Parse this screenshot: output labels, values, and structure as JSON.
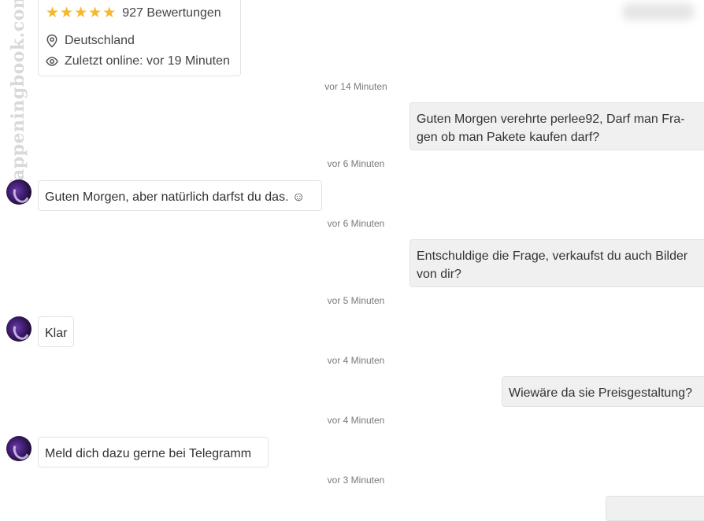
{
  "watermark": "fappeningbook.com",
  "profile": {
    "stars": 5,
    "rating_text": "927 Bewertungen",
    "location": "Deutschland",
    "last_online": "Zuletzt online: vor 19 Minuten"
  },
  "messages": [
    {
      "time": "vor 14 Minuten",
      "from": "me",
      "text": "Guten Morgen verehrte perlee92, Darf man Fra-\ngen ob man Pakete kaufen darf?"
    },
    {
      "time": "vor 6 Minuten",
      "from": "them",
      "text": "Guten Morgen, aber natürlich darfst du das. ☺"
    },
    {
      "time": "vor 6 Minuten",
      "from": "me",
      "text": "Entschuldige die Frage, verkaufst du auch Bilder\nvon dir?"
    },
    {
      "time": "vor 5 Minuten",
      "from": "them",
      "text": "Klar"
    },
    {
      "time": "vor 4 Minuten",
      "from": "me",
      "text": "Wiewäre da sie Preisgestaltung?"
    },
    {
      "time": "vor 4 Minuten",
      "from": "them",
      "text": "Meld dich dazu gerne bei Telegramm"
    },
    {
      "time": "vor 3 Minuten",
      "from": "me",
      "text": ""
    }
  ]
}
